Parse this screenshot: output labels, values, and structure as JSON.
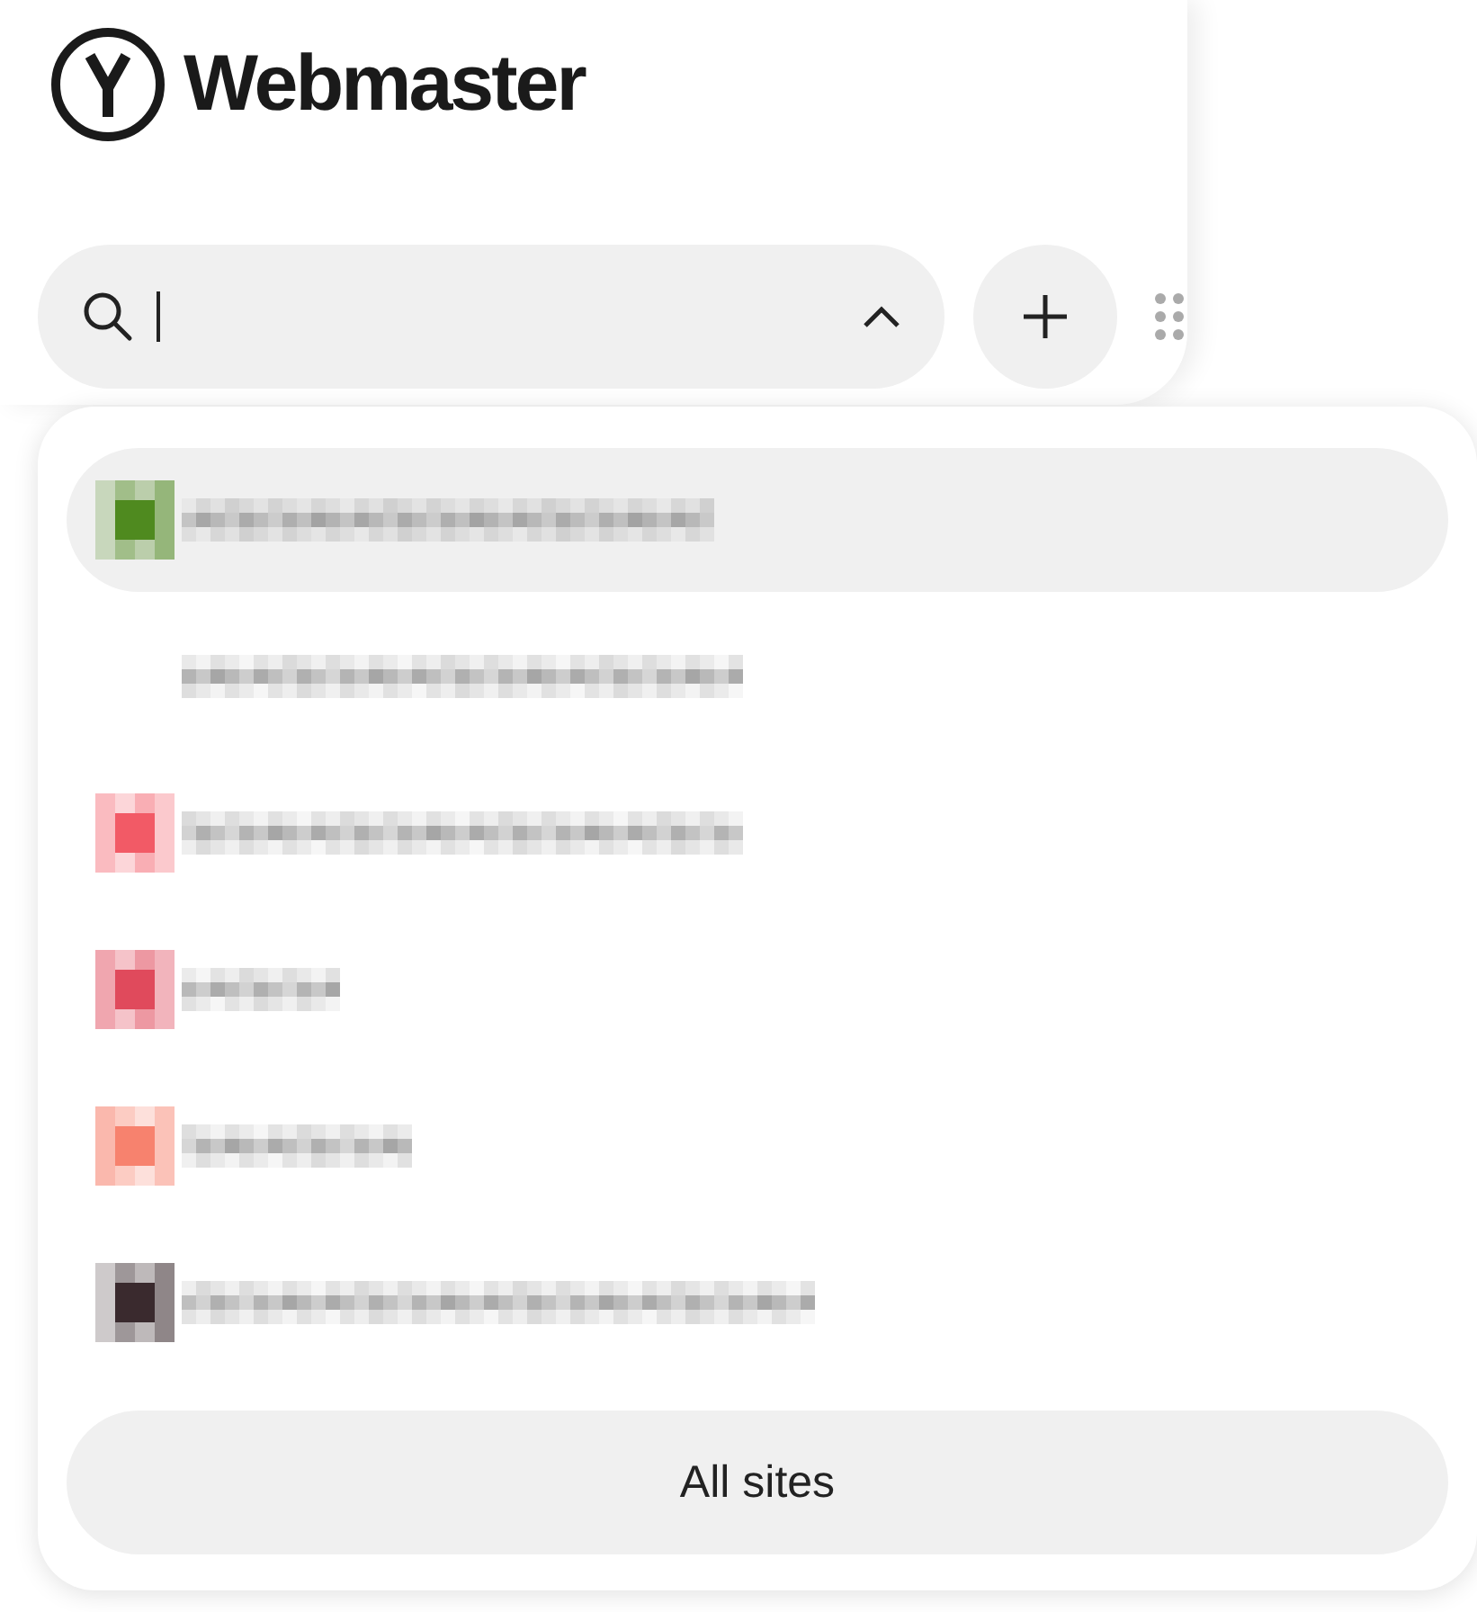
{
  "logo": {
    "text": "Webmaster"
  },
  "search": {
    "expanded": true
  },
  "sites": [
    {
      "selected": true,
      "color": "#4f8a1f"
    },
    {
      "selected": false
    },
    {
      "selected": false,
      "color": "#f25a66"
    },
    {
      "selected": false,
      "color": "#e04a5c"
    },
    {
      "selected": false,
      "color": "#f7826e"
    },
    {
      "selected": false,
      "color": "#3a2a2e"
    }
  ],
  "all_sites_button": "All sites"
}
